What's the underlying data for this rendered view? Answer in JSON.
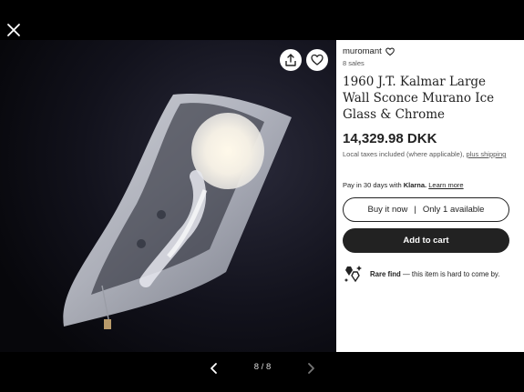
{
  "viewer": {
    "close_icon": "close-icon",
    "counter": "8 / 8",
    "prev_icon": "chevron-left-icon",
    "next_icon": "chevron-right-icon"
  },
  "photo": {
    "share_icon": "share-icon",
    "favorite_icon": "heart-icon"
  },
  "listing": {
    "shop_name": "muromant",
    "sales": "8 sales",
    "title": "1960 J.T. Kalmar Large Wall Sconce Murano Ice Glass & Chrome",
    "price": "14,329.98 DKK",
    "tax_note": "Local taxes included (where applicable),",
    "shipping_link": "plus shipping",
    "klarna_prefix": "Pay in 30 days with",
    "klarna_brand": "Klarna.",
    "klarna_link": "Learn more",
    "buy_now": "Buy it now",
    "buy_separator": "|",
    "availability": "Only 1 available",
    "add_to_cart": "Add to cart",
    "rare_label": "Rare find",
    "rare_desc": " — this item is hard to come by."
  },
  "colors": {
    "background": "#000000",
    "panel": "#ffffff",
    "text": "#222222",
    "muted": "#595959",
    "button_dark": "#222222"
  }
}
